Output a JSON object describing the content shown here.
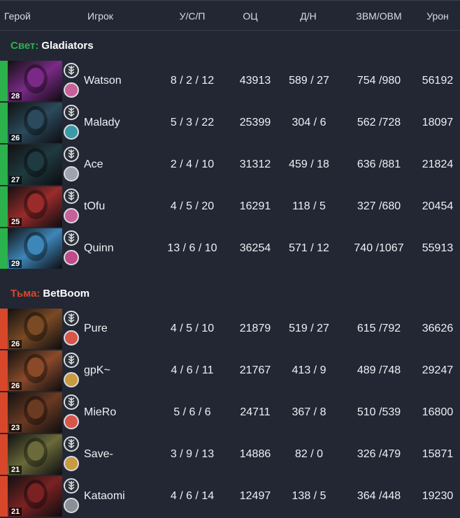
{
  "header": {
    "hero": "Герой",
    "player": "Игрок",
    "kda": "У/С/П",
    "nw": "ОЦ",
    "lhdn": "Д/Н",
    "gpmxpm": "ЗВМ/ОВМ",
    "dmg": "Урон"
  },
  "radiant": {
    "side": "Свет:",
    "name": "Gladiators",
    "color": "#2bb24c",
    "players": [
      {
        "level": "28",
        "player": "Watson",
        "kda": "8 / 2 / 12",
        "nw": "43913",
        "lhdn": "589 / 27",
        "gpmxpm": "754 /980",
        "dmg": "56192",
        "role_icon": "carry-icon",
        "portrait": "#7a2a86",
        "role_color": "#c9609a"
      },
      {
        "level": "26",
        "player": "Malady",
        "kda": "5 / 3 / 22",
        "nw": "25399",
        "lhdn": "304 / 6",
        "gpmxpm": "562 /728",
        "dmg": "18097",
        "role_icon": "support-icon",
        "portrait": "#2b4a5c",
        "role_color": "#3a9aa8"
      },
      {
        "level": "27",
        "player": "Ace",
        "kda": "2 / 4 / 10",
        "nw": "31312",
        "lhdn": "459 / 18",
        "gpmxpm": "636 /881",
        "dmg": "21824",
        "role_icon": "hourglass-icon",
        "portrait": "#1f3a40",
        "role_color": "#9ea4ad"
      },
      {
        "level": "25",
        "player": "tOfu",
        "kda": "4 / 5 / 20",
        "nw": "16291",
        "lhdn": "118 / 5",
        "gpmxpm": "327 /680",
        "dmg": "20454",
        "role_icon": "carry-icon",
        "portrait": "#9a2b2b",
        "role_color": "#c9609a"
      },
      {
        "level": "29",
        "player": "Quinn",
        "kda": "13 / 6 / 10",
        "nw": "36254",
        "lhdn": "571 / 12",
        "gpmxpm": "740 /1067",
        "dmg": "55913",
        "role_icon": "fist-icon",
        "portrait": "#3d86b8",
        "role_color": "#c04a8a"
      }
    ]
  },
  "dire": {
    "side": "Тьма:",
    "name": "BetBoom",
    "color": "#d9472b",
    "players": [
      {
        "level": "26",
        "player": "Pure",
        "kda": "4 / 5 / 10",
        "nw": "21879",
        "lhdn": "519 / 27",
        "gpmxpm": "615 /792",
        "dmg": "36626",
        "role_icon": "target-icon",
        "portrait": "#7a4a24",
        "role_color": "#d8554a"
      },
      {
        "level": "26",
        "player": "gpK~",
        "kda": "4 / 6 / 11",
        "nw": "21767",
        "lhdn": "413 / 9",
        "gpmxpm": "489 /748",
        "dmg": "29247",
        "role_icon": "sword-icon",
        "portrait": "#8a4a2a",
        "role_color": "#c99a40"
      },
      {
        "level": "23",
        "player": "MieRo",
        "kda": "5 / 6 / 6",
        "nw": "24711",
        "lhdn": "367 / 8",
        "gpmxpm": "510 /539",
        "dmg": "16800",
        "role_icon": "beast-icon",
        "portrait": "#6a3a22",
        "role_color": "#d8554a"
      },
      {
        "level": "21",
        "player": "Save-",
        "kda": "3 / 9 / 13",
        "nw": "14886",
        "lhdn": "82 / 0",
        "gpmxpm": "326 /479",
        "dmg": "15871",
        "role_icon": "fist-icon",
        "portrait": "#6a6a3a",
        "role_color": "#c99a40"
      },
      {
        "level": "21",
        "player": "Kataomi",
        "kda": "4 / 6 / 14",
        "nw": "12497",
        "lhdn": "138 / 5",
        "gpmxpm": "364 /448",
        "dmg": "19230",
        "role_icon": "xp-icon",
        "portrait": "#7a2222",
        "role_color": "#8a8f98"
      }
    ]
  }
}
